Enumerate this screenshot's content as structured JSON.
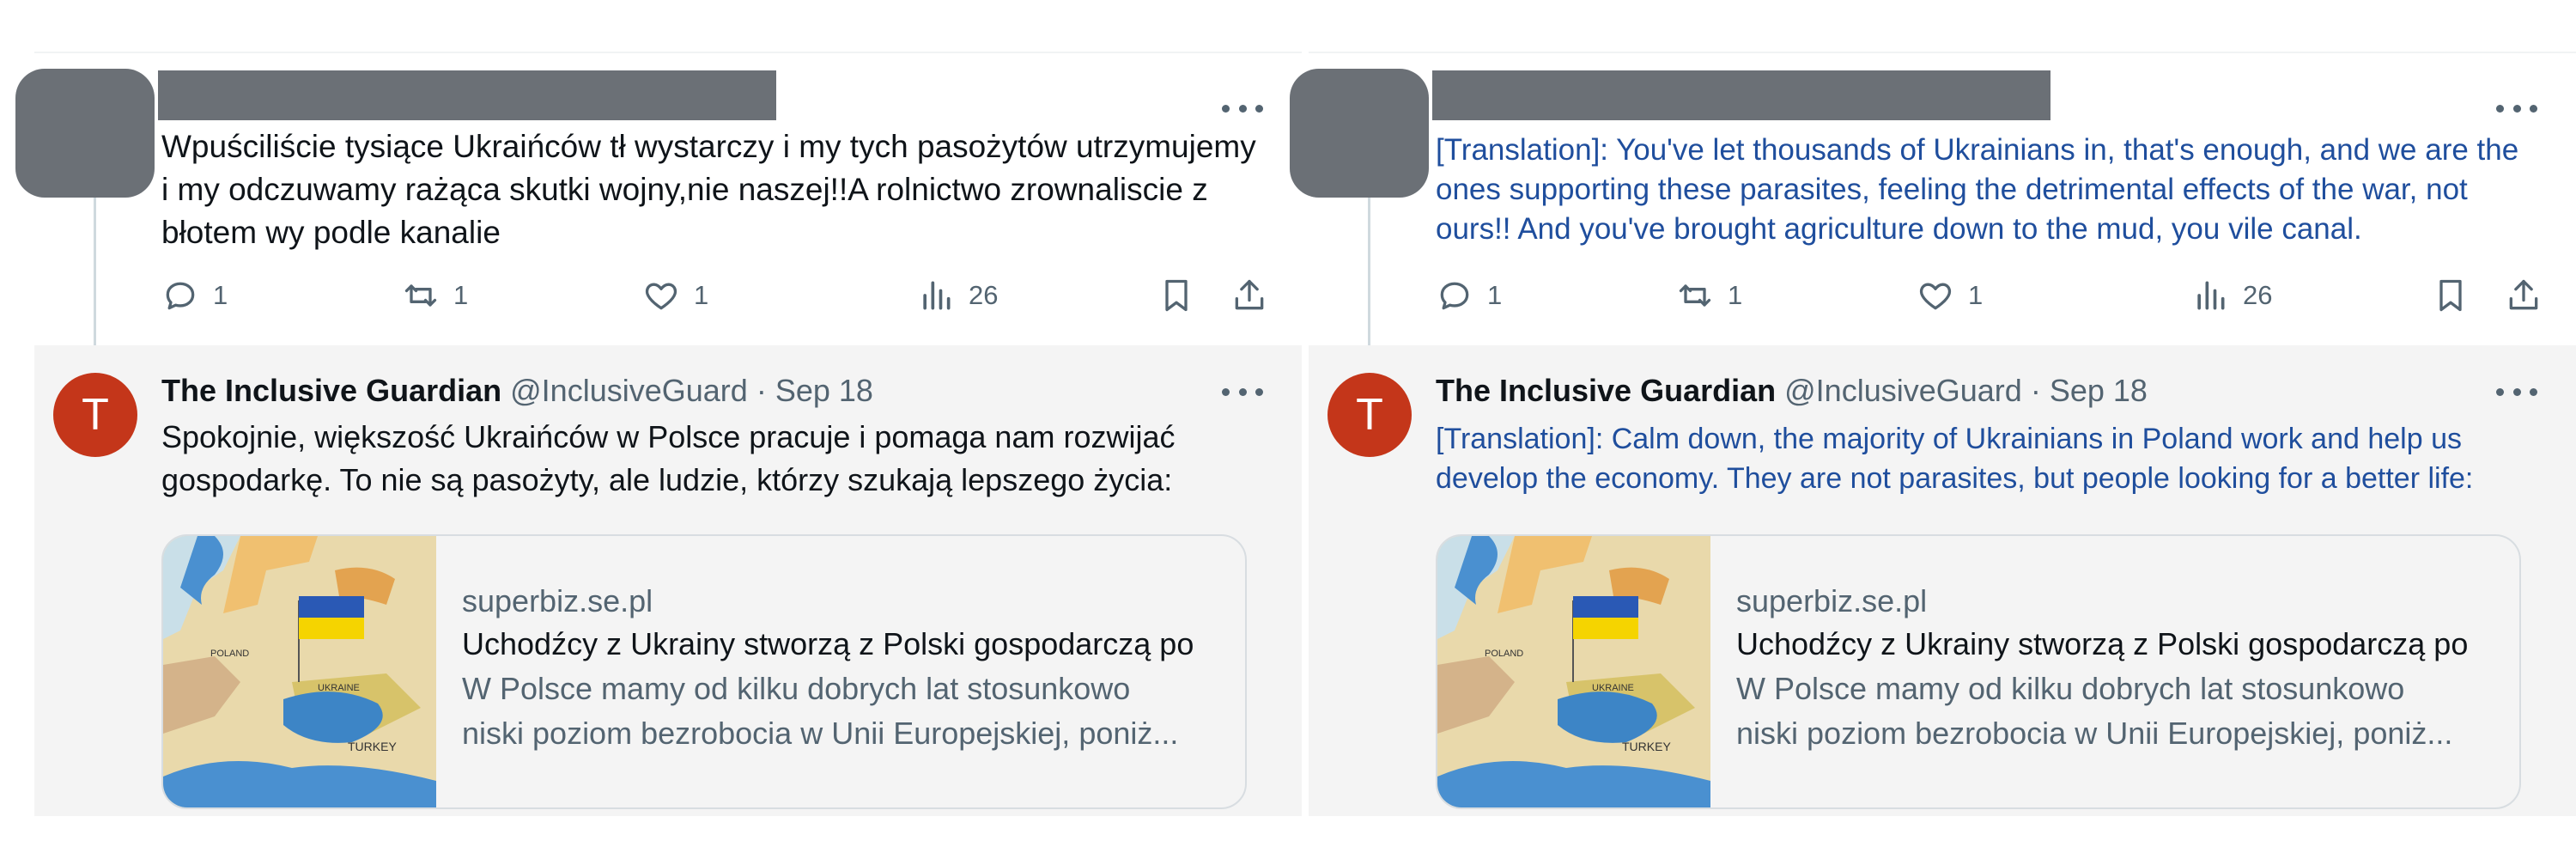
{
  "left": {
    "tweet": {
      "text": "Wpuściliście tysiące Ukraińców  tł wystarczy i my tych pasożytów utrzymujemy i my odczuwamy rażąca skutki wojny,nie naszej!!A rolnictwo zrownaliscie z błotem wy podle kanalie",
      "metrics": {
        "replies": "1",
        "retweets": "1",
        "likes": "1",
        "views": "26"
      }
    },
    "reply": {
      "avatar_letter": "T",
      "name": "The Inclusive Guardian",
      "handle": "@InclusiveGuard",
      "separator": "·",
      "date": "Sep 18",
      "text": "Spokojnie, większość Ukraińców w Polsce pracuje i pomaga nam rozwijać gospodarkę. To nie są pasożyty, ale ludzie, którzy szukają lepszego życia:",
      "card": {
        "domain": "superbiz.se.pl",
        "title": "Uchodźcy z Ukrainy stworzą z Polski gospodarczą po",
        "desc_line1": "W Polsce mamy od kilku dobrych lat stosunkowo",
        "desc_line2": "niski poziom bezrobocia w Unii Europejskiej, poniż..."
      }
    }
  },
  "right": {
    "tweet": {
      "text": "[Translation]: You've let thousands of Ukrainians in, that's enough, and we are the ones supporting these parasites, feeling the detrimental effects of the war, not ours!! And you've brought agriculture down to the mud, you vile canal.",
      "metrics": {
        "replies": "1",
        "retweets": "1",
        "likes": "1",
        "views": "26"
      }
    },
    "reply": {
      "avatar_letter": "T",
      "name": "The Inclusive Guardian",
      "handle": "@InclusiveGuard",
      "separator": "·",
      "date": "Sep 18",
      "text": "[Translation]: Calm down, the majority of Ukrainians in Poland work and help us develop the economy. They are not parasites, but people looking for a better life:",
      "card": {
        "domain": "superbiz.se.pl",
        "title": "Uchodźcy z Ukrainy stworzą z Polski gospodarczą po",
        "desc_line1": "W Polsce mamy od kilku dobrych lat stosunkowo",
        "desc_line2": "niski poziom bezrobocia w Unii Europejskiej, poniż..."
      }
    }
  },
  "map_labels": {
    "poland": "POLAND",
    "ukraine": "UKRAINE",
    "turkey": "TURKEY"
  },
  "colors": {
    "redacted_gray": "#6b7076",
    "avatar_red": "#c4361a",
    "translation_blue": "#1f4e9d",
    "muted": "#536471",
    "reply_bg": "#f4f4f4",
    "flag_blue": "#2a59b5",
    "flag_yellow": "#f5d400"
  },
  "icons": [
    "more-icon",
    "reply-icon",
    "retweet-icon",
    "like-icon",
    "views-icon",
    "bookmark-icon",
    "share-icon"
  ]
}
